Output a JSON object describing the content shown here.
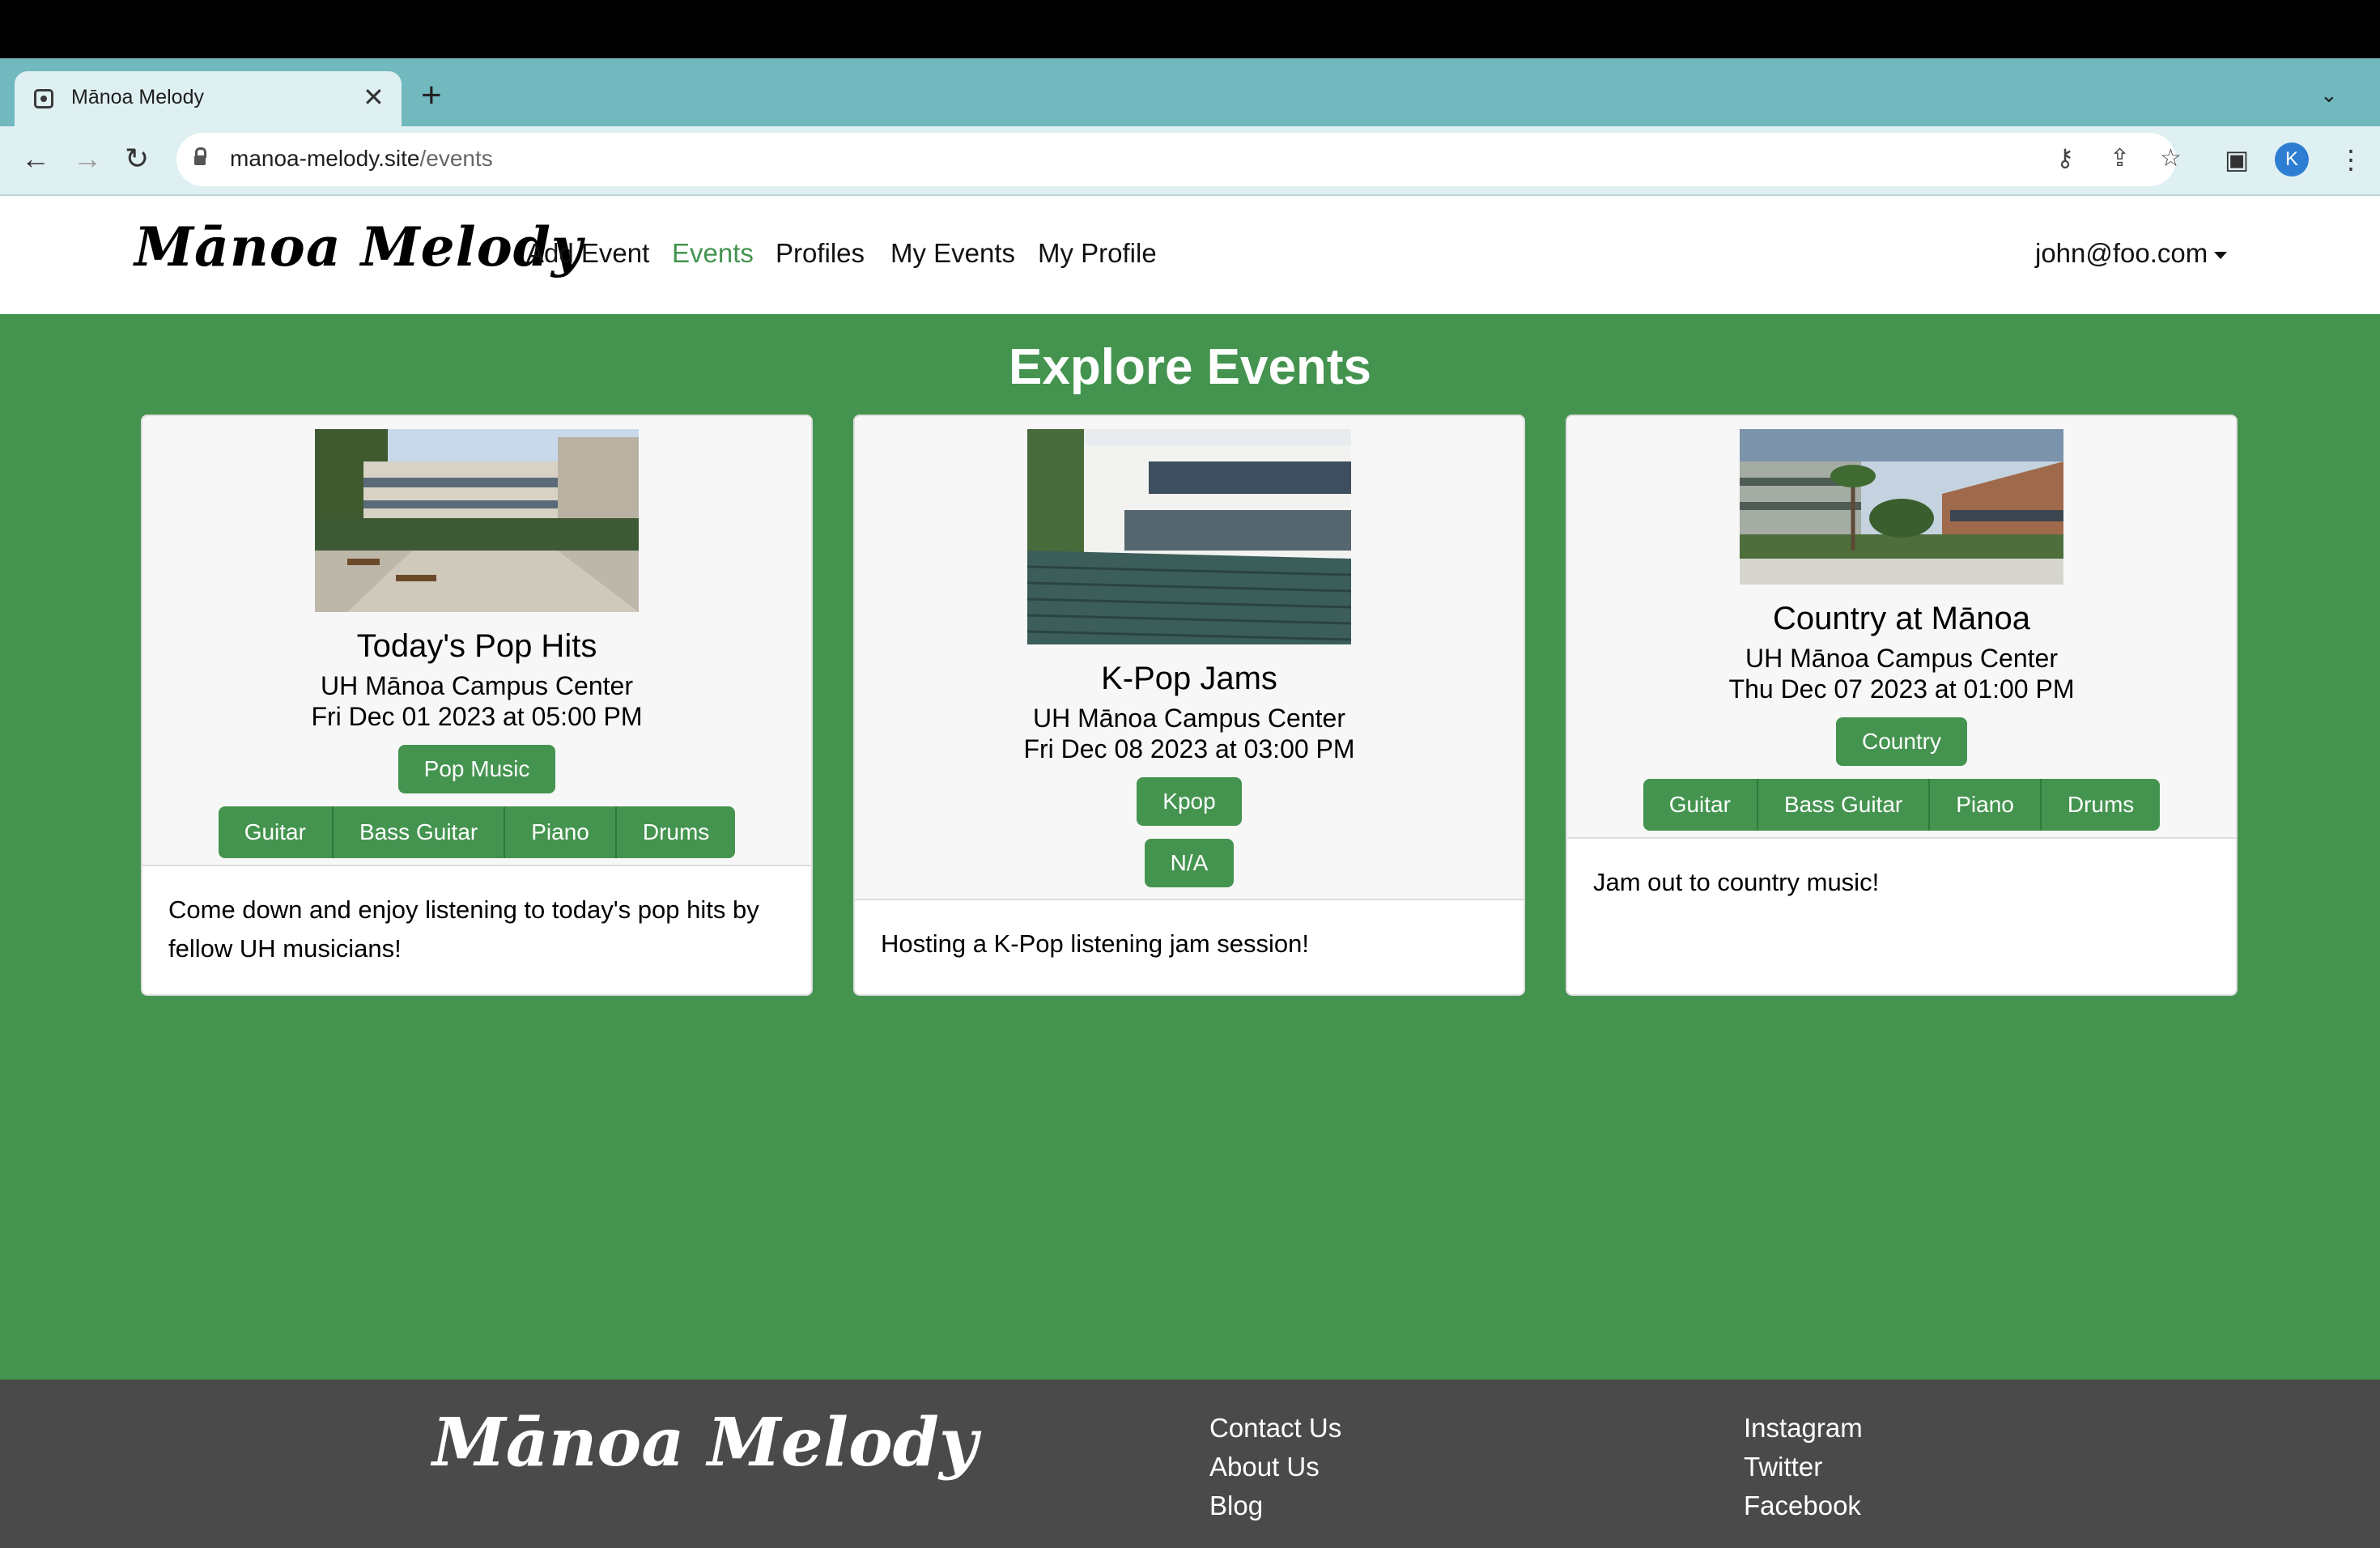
{
  "browser": {
    "tab_title": "Mānoa Melody",
    "url_domain": "manoa-melody.site",
    "url_path": "/events"
  },
  "navbar": {
    "brand": "Mānoa Melody",
    "links": [
      "Add Event",
      "Events",
      "Profiles",
      "My Events",
      "My Profile"
    ],
    "active_link": "Events",
    "user": "john@foo.com"
  },
  "page": {
    "heading": "Explore Events"
  },
  "events": [
    {
      "title": "Today's Pop Hits",
      "location": "UH Mānoa Campus Center",
      "date": "Fri Dec 01 2023 at 05:00 PM",
      "genres": [
        "Pop Music"
      ],
      "instruments": [
        "Guitar",
        "Bass Guitar",
        "Piano",
        "Drums"
      ],
      "description": "Come down and enjoy listening to today's pop hits by fellow UH musicians!"
    },
    {
      "title": "K-Pop Jams",
      "location": "UH Mānoa Campus Center",
      "date": "Fri Dec 08 2023 at 03:00 PM",
      "genres": [
        "Kpop",
        "N/A"
      ],
      "instruments": [],
      "description": "Hosting a K-Pop listening jam session!"
    },
    {
      "title": "Country at Mānoa",
      "location": "UH Mānoa Campus Center",
      "date": "Thu Dec 07 2023 at 01:00 PM",
      "genres": [
        "Country"
      ],
      "instruments": [
        "Guitar",
        "Bass Guitar",
        "Piano",
        "Drums"
      ],
      "description": "Jam out to country music!"
    }
  ],
  "footer": {
    "brand": "Mānoa Melody",
    "col1": [
      "Contact Us",
      "About Us",
      "Blog"
    ],
    "col2": [
      "Instagram",
      "Twitter",
      "Facebook"
    ]
  },
  "colors": {
    "accent": "#44944f",
    "footer_bg": "#4a4a4a",
    "chrome_tab": "#72b8bf"
  }
}
